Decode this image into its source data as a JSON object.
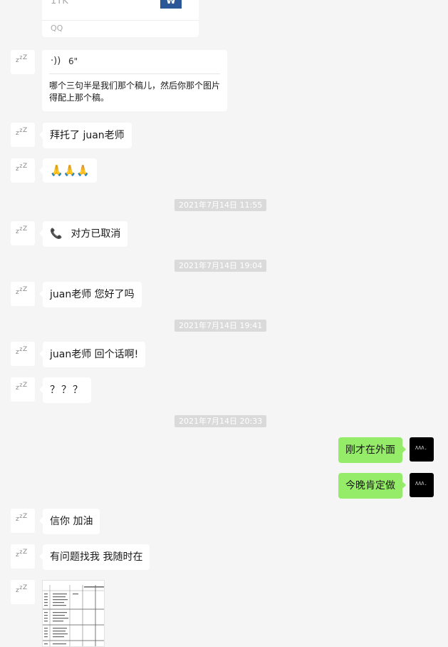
{
  "top_card": {
    "partial_text": "1TK",
    "source_label": "QQ",
    "app_badge": "W"
  },
  "voice_card": {
    "duration": "6\"",
    "transcript_line1": "哪个三句半是我们那个稿儿，然后你那个图片",
    "transcript_line2": "得配上那个稿。"
  },
  "messages": {
    "m1": "拜托了 juan老师",
    "m2": "🙏🙏🙏",
    "t1": "2021年7月14日 11:55",
    "m3_call": "对方已取消",
    "t2": "2021年7月14日 19:04",
    "m4": "juan老师 您好了吗",
    "t3": "2021年7月14日 19:41",
    "m5": "juan老师 回个话啊!",
    "m6": "？？？",
    "t4": "2021年7月14日 20:33",
    "r1": "刚才在外面",
    "r2": "今晚肯定做",
    "m7": "信你 加油",
    "m8": "有问题找我 我随时在"
  },
  "avatars": {
    "contact_glyph": "zzZ",
    "me_glyph": "ΛΛΛ."
  },
  "icons": {
    "voice": "voice-wave-icon",
    "call": "phone-icon"
  },
  "colors": {
    "background": "#f5f5f5",
    "my_bubble": "#95ec69",
    "their_bubble": "#ffffff",
    "timestamp_bg": "#dadada"
  }
}
